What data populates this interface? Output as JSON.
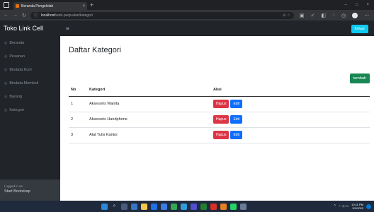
{
  "browser": {
    "tab_title": "Beranda Pengelolah",
    "tab_close": "×",
    "new_tab": "+",
    "win_controls": {
      "minimize": "–",
      "maximize": "□",
      "close": "×"
    },
    "nav": {
      "back": "←",
      "forward": "→",
      "reload": "↻"
    },
    "info_icon": "ⓘ",
    "url_host": "localhost",
    "url_path": "/web-penjualan/kategori"
  },
  "app": {
    "brand": "Toko Link Cell",
    "toggle_icon": "≡",
    "logout_label": "Keluar"
  },
  "sidebar": {
    "items": [
      {
        "icon": "◎",
        "label": "Beranda"
      },
      {
        "icon": "◎",
        "label": "Pesanan"
      },
      {
        "icon": "◎",
        "label": "Biodata Kurir"
      },
      {
        "icon": "◎",
        "label": "Biodata Membeli"
      },
      {
        "icon": "◎",
        "label": "Barang"
      },
      {
        "icon": "◎",
        "label": "Kategori"
      }
    ],
    "footer_small": "Logged in as:",
    "footer_user": "Start Bootstrap"
  },
  "main": {
    "title": "Daftar Kategori",
    "add_button": "tambah",
    "table": {
      "headers": [
        "No",
        "Kategori",
        "Aksi"
      ],
      "rows": [
        {
          "no": "1",
          "kategori": "Aksesoris Wanita"
        },
        {
          "no": "2",
          "kategori": "Aksesoris Handphone"
        },
        {
          "no": "3",
          "kategori": "Alat Tulis Kantor"
        }
      ],
      "delete_label": "Hapus",
      "edit_label": "Edit"
    }
  },
  "taskbar": {
    "time": "10:11 PM",
    "date": "3/1/2022",
    "tray_chevron": "^",
    "tray_icons": "◔ ◁ ▭"
  },
  "colors": {
    "accent_info": "#0dcaf0",
    "success": "#198754",
    "danger": "#dc3545",
    "primary": "#0d6efd",
    "sidebar": "#212529"
  }
}
